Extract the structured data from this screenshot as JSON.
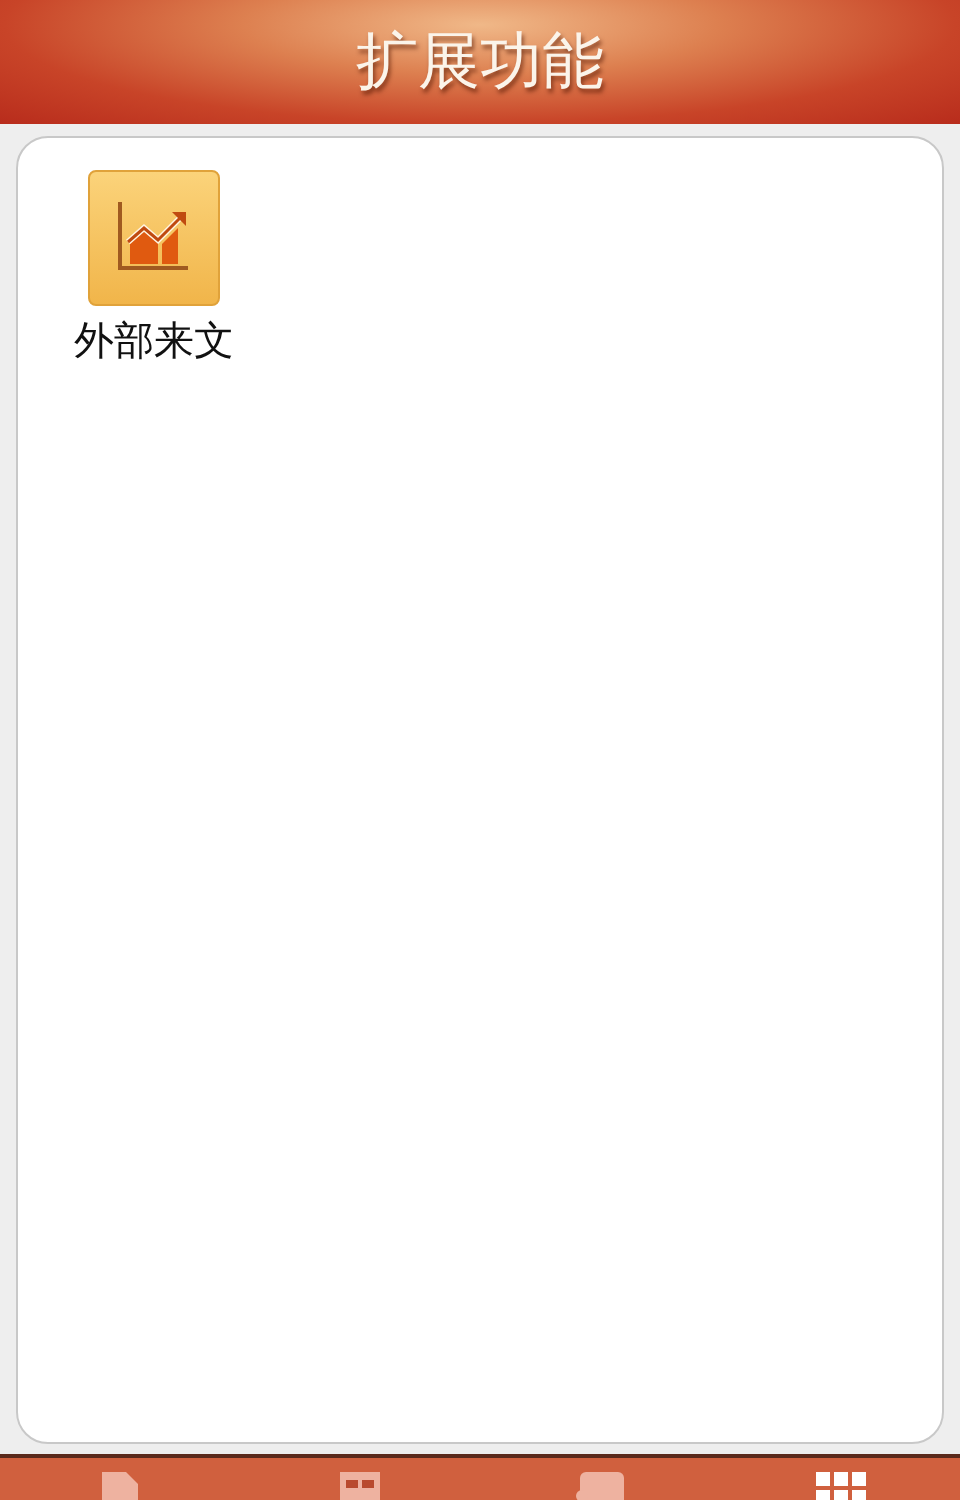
{
  "header": {
    "title": "扩展功能"
  },
  "apps": [
    {
      "label": "外部来文"
    }
  ],
  "tab_bar": {
    "tabs": [
      {
        "selected": false
      },
      {
        "selected": false
      },
      {
        "selected": false
      },
      {
        "selected": true
      }
    ]
  }
}
